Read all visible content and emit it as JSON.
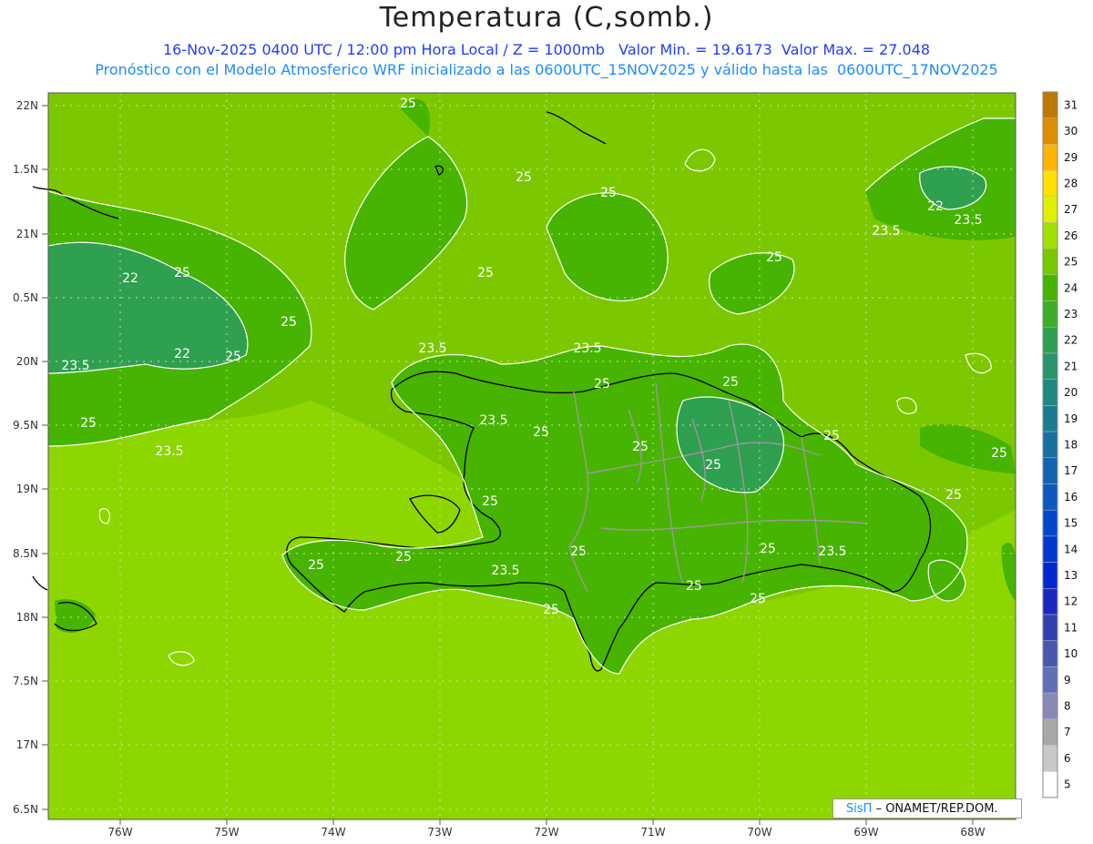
{
  "header": {
    "title": "Temperatura (C,somb.)",
    "line1": "16-Nov-2025 0400 UTC / 12:00 pm Hora Local / Z = 1000mb   Valor Min. = 19.6173  Valor Max. = 27.048",
    "line2": "Pronóstico con el Modelo Atmosferico WRF inicializado a las 0600UTC_15NOV2025 y válido hasta las  0600UTC_17NOV2025"
  },
  "axes": {
    "lat_labels": [
      "22N",
      "1.5N",
      "21N",
      "0.5N",
      "20N",
      "9.5N",
      "19N",
      "8.5N",
      "18N",
      "7.5N",
      "17N",
      "6.5N"
    ],
    "lon_labels": [
      "76W",
      "75W",
      "74W",
      "73W",
      "72W",
      "71W",
      "70W",
      "69W",
      "68W"
    ]
  },
  "colorbar": {
    "levels": [
      "31",
      "30",
      "29",
      "28",
      "27",
      "26",
      "25",
      "24",
      "23",
      "22",
      "21",
      "20",
      "19",
      "18",
      "17",
      "16",
      "15",
      "14",
      "13",
      "12",
      "11",
      "10",
      "9",
      "8",
      "7",
      "6",
      "5"
    ],
    "colors": [
      "#c07800",
      "#e08c00",
      "#ffb400",
      "#ffe000",
      "#e0f000",
      "#a0e000",
      "#78c800",
      "#46b400",
      "#3cae28",
      "#2ea050",
      "#289470",
      "#1f8880",
      "#1a7c90",
      "#1670a0",
      "#1064b0",
      "#0a58c0",
      "#0048c8",
      "#0038d0",
      "#0028d0",
      "#1828c0",
      "#3040b0",
      "#4858b0",
      "#6070b8",
      "#8888b8",
      "#a8a8a8",
      "#c8c8c8",
      "#ffffff"
    ]
  },
  "contour_labels": [
    "25",
    "25",
    "25",
    "25",
    "25",
    "22",
    "23.5",
    "23.5",
    "22",
    "25",
    "22",
    "23.5",
    "25",
    "25",
    "25",
    "23.5",
    "23.5",
    "23.5",
    "25",
    "23.5",
    "25",
    "25",
    "25",
    "25",
    "25",
    "25",
    "25",
    "25",
    "25",
    "25",
    "25",
    "23.5",
    "25",
    "25",
    "25",
    "23.5",
    "25"
  ],
  "credit": {
    "brand": "SisΠ",
    "org": "– ONAMET/REP.DOM."
  }
}
